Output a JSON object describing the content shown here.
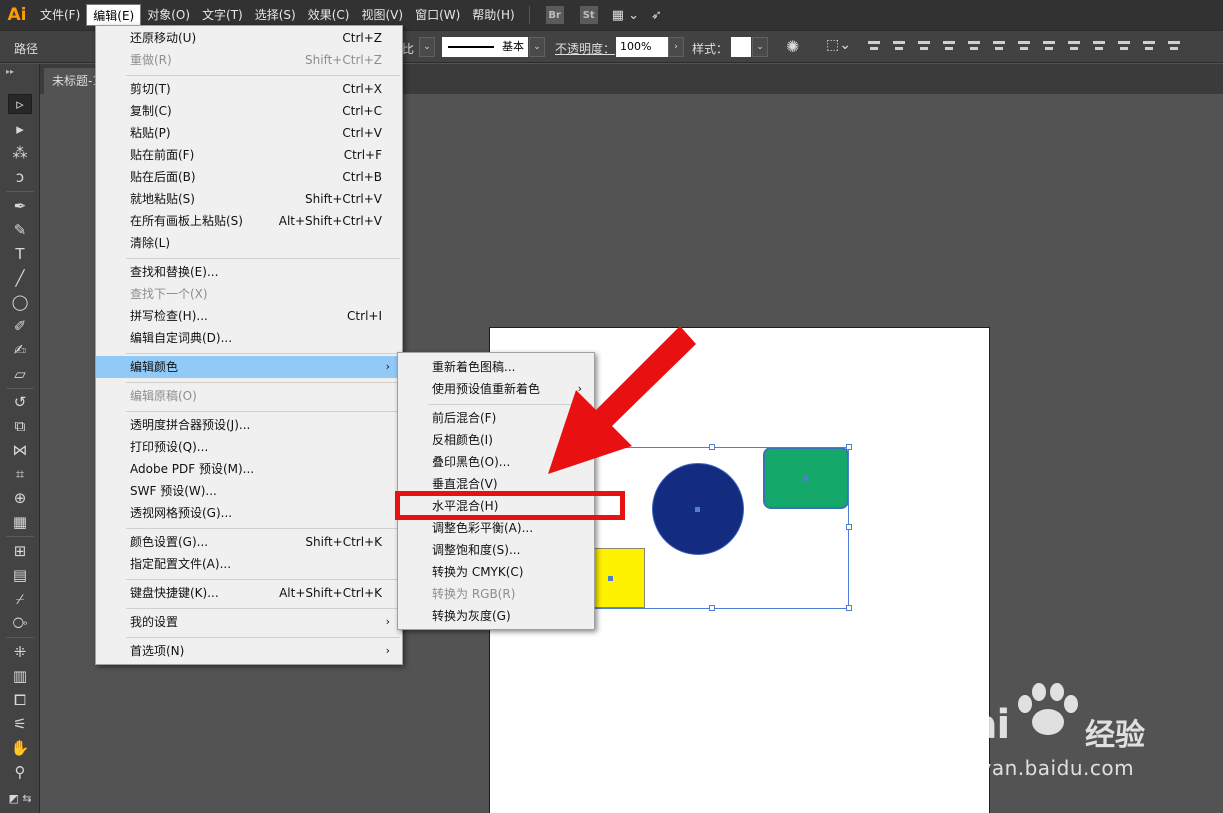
{
  "app": {
    "logo": "Ai"
  },
  "menubar": {
    "items": [
      "文件(F)",
      "编辑(E)",
      "对象(O)",
      "文字(T)",
      "选择(S)",
      "效果(C)",
      "视图(V)",
      "窗口(W)",
      "帮助(H)"
    ],
    "badges": [
      "Br",
      "St"
    ]
  },
  "controlbar": {
    "label_path": "路径",
    "ratio_label": "比",
    "stroke_style": "基本",
    "opacity_label": "不透明度：",
    "opacity_value": "100%",
    "style_label": "样式："
  },
  "document": {
    "tab_title": "未标题-1"
  },
  "edit_menu": [
    {
      "label": "还原移动(U)",
      "shortcut": "Ctrl+Z"
    },
    {
      "label": "重做(R)",
      "shortcut": "Shift+Ctrl+Z",
      "disabled": true
    },
    {
      "label": "剪切(T)",
      "shortcut": "Ctrl+X"
    },
    {
      "label": "复制(C)",
      "shortcut": "Ctrl+C"
    },
    {
      "label": "粘贴(P)",
      "shortcut": "Ctrl+V"
    },
    {
      "label": "贴在前面(F)",
      "shortcut": "Ctrl+F"
    },
    {
      "label": "贴在后面(B)",
      "shortcut": "Ctrl+B"
    },
    {
      "label": "就地粘贴(S)",
      "shortcut": "Shift+Ctrl+V"
    },
    {
      "label": "在所有画板上粘贴(S)",
      "shortcut": "Alt+Shift+Ctrl+V"
    },
    {
      "label": "清除(L)",
      "shortcut": ""
    },
    {
      "label": "查找和替换(E)...",
      "shortcut": ""
    },
    {
      "label": "查找下一个(X)",
      "shortcut": "",
      "disabled": true
    },
    {
      "label": "拼写检查(H)...",
      "shortcut": "Ctrl+I"
    },
    {
      "label": "编辑自定词典(D)...",
      "shortcut": ""
    },
    {
      "label": "编辑颜色",
      "shortcut": "",
      "submenu": true,
      "highlighted": true
    },
    {
      "label": "编辑原稿(O)",
      "shortcut": "",
      "disabled": true
    },
    {
      "label": "透明度拼合器预设(J)...",
      "shortcut": ""
    },
    {
      "label": "打印预设(Q)...",
      "shortcut": ""
    },
    {
      "label": "Adobe PDF 预设(M)...",
      "shortcut": ""
    },
    {
      "label": "SWF 预设(W)...",
      "shortcut": ""
    },
    {
      "label": "透视网格预设(G)...",
      "shortcut": ""
    },
    {
      "label": "颜色设置(G)...",
      "shortcut": "Shift+Ctrl+K"
    },
    {
      "label": "指定配置文件(A)...",
      "shortcut": ""
    },
    {
      "label": "键盘快捷键(K)...",
      "shortcut": "Alt+Shift+Ctrl+K"
    },
    {
      "label": "我的设置",
      "shortcut": "",
      "submenu": true
    },
    {
      "label": "首选项(N)",
      "shortcut": "",
      "submenu": true
    }
  ],
  "color_submenu": [
    {
      "label": "重新着色图稿..."
    },
    {
      "label": "使用预设值重新着色",
      "submenu": true
    },
    {
      "label": "前后混合(F)"
    },
    {
      "label": "反相颜色(I)"
    },
    {
      "label": "叠印黑色(O)..."
    },
    {
      "label": "垂直混合(V)"
    },
    {
      "label": "水平混合(H)",
      "annotated": true
    },
    {
      "label": "调整色彩平衡(A)..."
    },
    {
      "label": "调整饱和度(S)..."
    },
    {
      "label": "转换为 CMYK(C)"
    },
    {
      "label": "转换为 RGB(R)",
      "disabled": true
    },
    {
      "label": "转换为灰度(G)"
    }
  ],
  "canvas": {
    "shapes": [
      {
        "name": "yellow-rectangle",
        "color": "#fff200"
      },
      {
        "name": "blue-circle",
        "color": "#142c80"
      },
      {
        "name": "green-rounded-rectangle",
        "color": "#14a96a"
      }
    ]
  },
  "colors": {
    "highlight": "#91c9f7",
    "annotation": "#e81010",
    "selection": "#4f7fd1",
    "app_accent": "#ff9a00"
  },
  "watermark": {
    "brand": "Bai",
    "brand_cn": "经验",
    "url": "jingyan.baidu.com"
  }
}
